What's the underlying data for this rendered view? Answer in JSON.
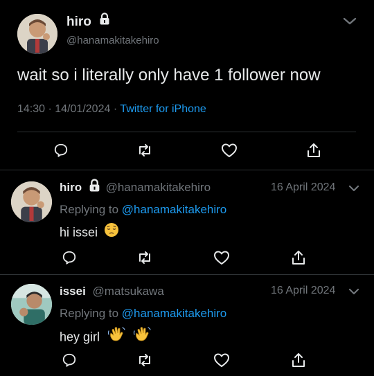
{
  "colors": {
    "background": "#000000",
    "text": "#e7e9ea",
    "secondary": "#71767b",
    "accent": "#1d9bf0",
    "divider": "#2f3336"
  },
  "main_tweet": {
    "author": {
      "display_name": "hiro",
      "handle": "@hanamakitakehiro",
      "locked": true,
      "avatar_icon": "avatar-hiro"
    },
    "text": "wait so i literally only have 1 follower now",
    "time": "14:30",
    "date": "14/01/2024",
    "separator": "·",
    "source": "Twitter for iPhone",
    "actions": [
      "reply-icon",
      "retweet-icon",
      "like-icon",
      "share-icon"
    ]
  },
  "replies": [
    {
      "author": {
        "display_name": "hiro",
        "handle": "@hanamakitakehiro",
        "locked": true,
        "avatar_icon": "avatar-hiro"
      },
      "date": "16 April 2024",
      "replying_prefix": "Replying to",
      "replying_to": "@hanamakitakehiro",
      "text": "hi issei",
      "emoji": [
        "pensive-face"
      ]
    },
    {
      "author": {
        "display_name": "issei",
        "handle": "@matsukawa",
        "locked": false,
        "avatar_icon": "avatar-issei"
      },
      "date": "16 April 2024",
      "replying_prefix": "Replying to",
      "replying_to": "@hanamakitakehiro",
      "text": "hey girl",
      "emoji": [
        "waving-hand",
        "waving-hand"
      ]
    }
  ]
}
